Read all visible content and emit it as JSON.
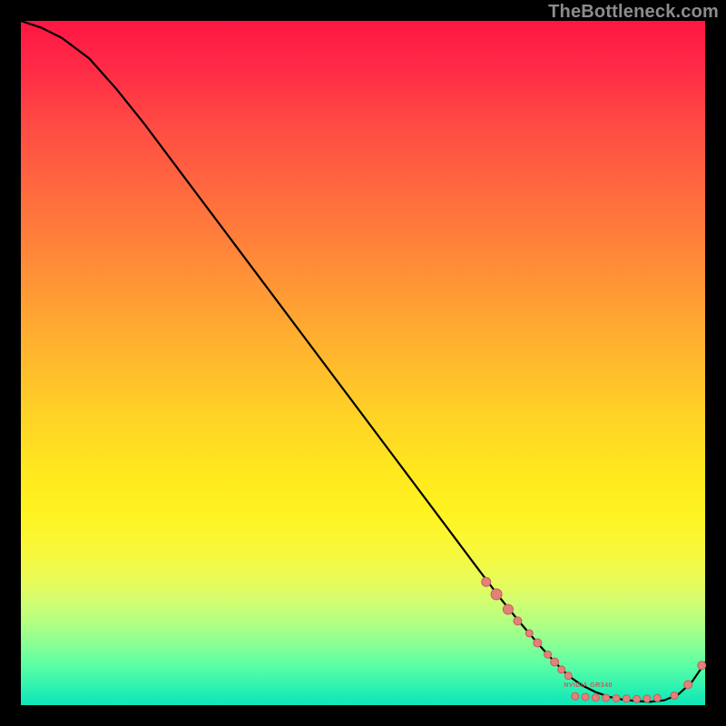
{
  "watermark": "TheBottleneck.com",
  "small_label": "NVIDIA GR340",
  "colors": {
    "curve": "#000000",
    "marker_fill": "#e38179",
    "marker_stroke": "#c25f5f"
  },
  "chart_data": {
    "type": "line",
    "title": "",
    "xlabel": "",
    "ylabel": "",
    "xlim": [
      0,
      100
    ],
    "ylim": [
      0,
      100
    ],
    "series": [
      {
        "name": "bottleneck-curve",
        "x": [
          0,
          3,
          6,
          10,
          14,
          18,
          24,
          30,
          36,
          42,
          48,
          54,
          60,
          66,
          70,
          73,
          76,
          78,
          80,
          82,
          84,
          86,
          88,
          90,
          92,
          94,
          96,
          98,
          100
        ],
        "y": [
          100,
          99,
          97.5,
          94.5,
          90,
          85,
          77,
          69,
          61,
          53,
          45,
          37,
          29,
          21,
          15.7,
          12,
          8.5,
          6.3,
          4.3,
          2.9,
          1.9,
          1.2,
          0.8,
          0.6,
          0.5,
          0.7,
          1.5,
          3.3,
          6.2
        ]
      }
    ],
    "markers": {
      "name": "gpu-points",
      "points": [
        {
          "x": 68.0,
          "y": 18.0,
          "r": 5.0
        },
        {
          "x": 69.5,
          "y": 16.2,
          "r": 6.0
        },
        {
          "x": 71.2,
          "y": 14.0,
          "r": 5.5
        },
        {
          "x": 72.6,
          "y": 12.3,
          "r": 4.5
        },
        {
          "x": 74.3,
          "y": 10.5,
          "r": 4.0
        },
        {
          "x": 75.5,
          "y": 9.1,
          "r": 4.5
        },
        {
          "x": 77.0,
          "y": 7.4,
          "r": 4.0
        },
        {
          "x": 78.0,
          "y": 6.3,
          "r": 4.5
        },
        {
          "x": 79.0,
          "y": 5.2,
          "r": 4.0
        },
        {
          "x": 80.0,
          "y": 4.3,
          "r": 4.0
        },
        {
          "x": 81.0,
          "y": 1.3,
          "r": 4.0
        },
        {
          "x": 82.5,
          "y": 1.2,
          "r": 4.0
        },
        {
          "x": 84.0,
          "y": 1.1,
          "r": 4.0
        },
        {
          "x": 85.5,
          "y": 1.05,
          "r": 4.0
        },
        {
          "x": 87.0,
          "y": 1.0,
          "r": 4.0
        },
        {
          "x": 88.5,
          "y": 0.95,
          "r": 4.0
        },
        {
          "x": 90.0,
          "y": 0.9,
          "r": 4.0
        },
        {
          "x": 91.5,
          "y": 0.95,
          "r": 4.0
        },
        {
          "x": 93.0,
          "y": 1.05,
          "r": 4.0
        },
        {
          "x": 95.5,
          "y": 1.4,
          "r": 4.0
        },
        {
          "x": 97.5,
          "y": 3.0,
          "r": 4.5
        },
        {
          "x": 99.5,
          "y": 5.8,
          "r": 4.5
        }
      ]
    },
    "label_anchor": {
      "x": 82,
      "y": 2.2
    }
  }
}
